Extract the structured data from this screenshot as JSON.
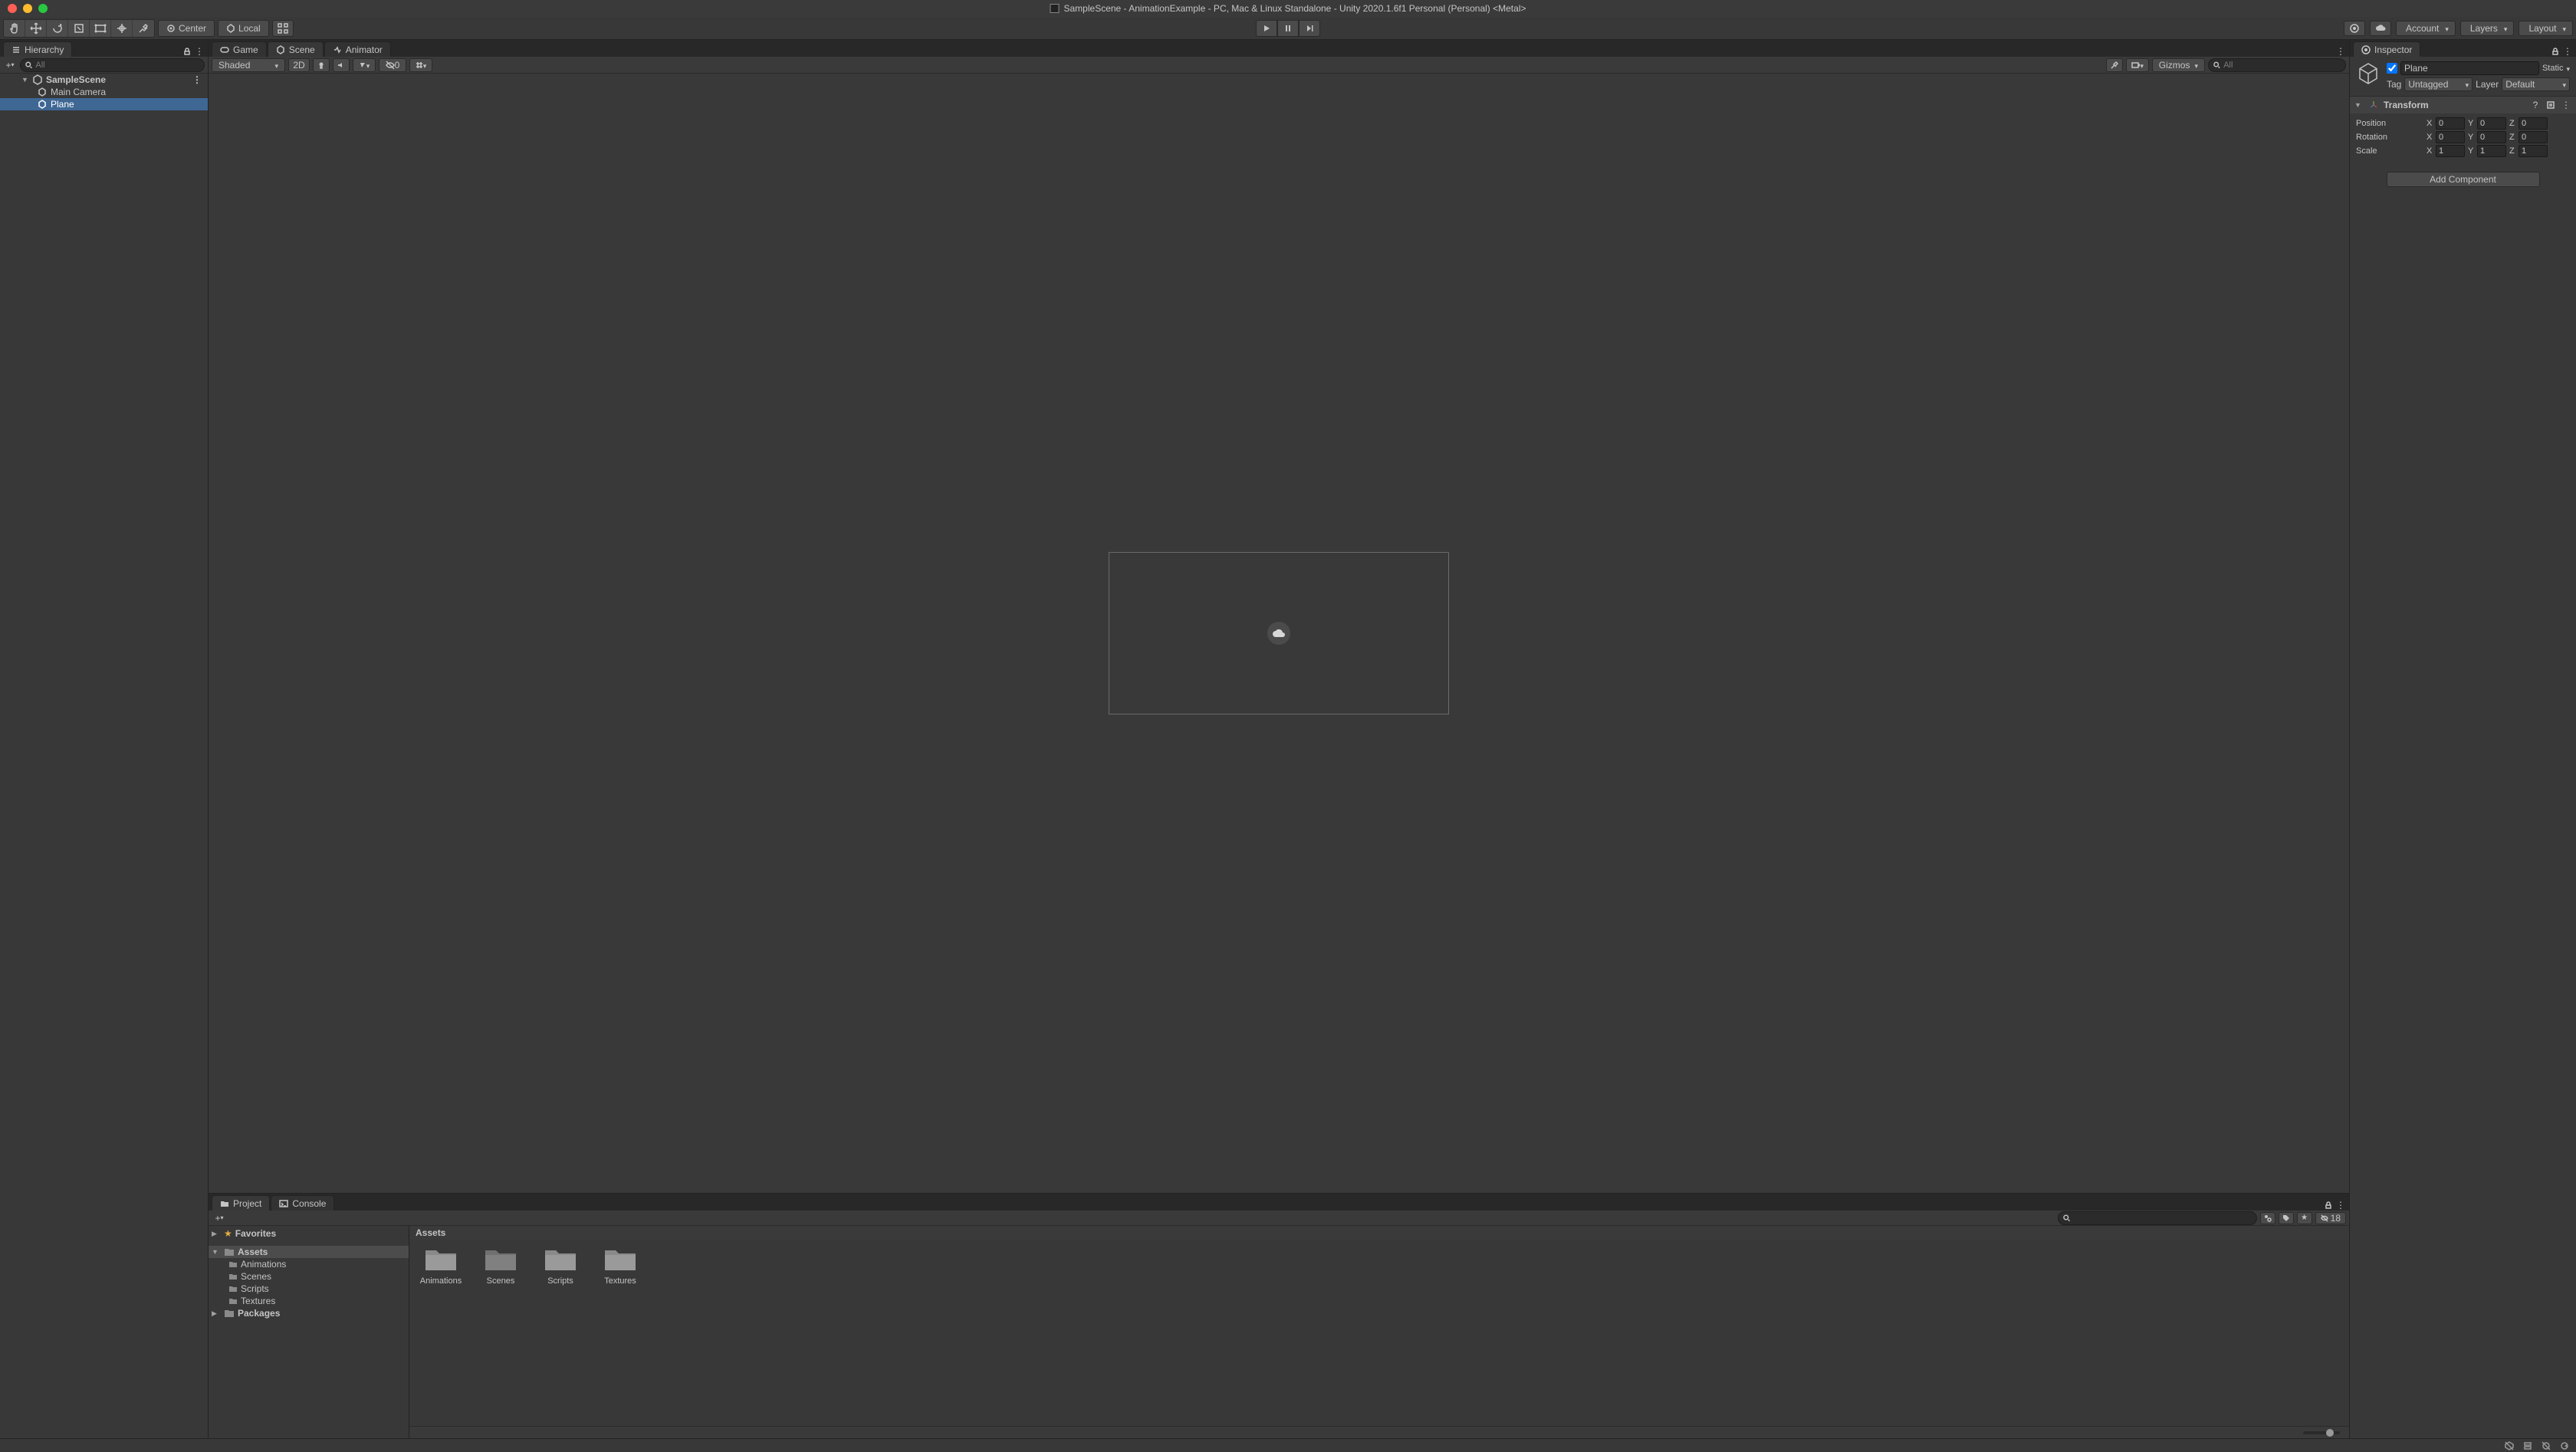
{
  "titlebar": {
    "title": "SampleScene - AnimationExample - PC, Mac & Linux Standalone - Unity 2020.1.6f1 Personal (Personal) <Metal>"
  },
  "toolbar": {
    "pivot_center": "Center",
    "pivot_local": "Local",
    "account": "Account",
    "layers": "Layers",
    "layout": "Layout"
  },
  "hierarchy": {
    "tab": "Hierarchy",
    "search_placeholder": "All",
    "scene": "SampleScene",
    "items": [
      "Main Camera",
      "Plane"
    ],
    "selected": "Plane"
  },
  "center_tabs": {
    "game": "Game",
    "scene": "Scene",
    "animator": "Animator"
  },
  "scene": {
    "shading": "Shaded",
    "mode2d": "2D",
    "gizmos": "Gizmos",
    "cull_count": "0",
    "search_placeholder": "All"
  },
  "inspector": {
    "tab": "Inspector",
    "name": "Plane",
    "static": "Static",
    "tag_label": "Tag",
    "tag_value": "Untagged",
    "layer_label": "Layer",
    "layer_value": "Default",
    "transform": {
      "title": "Transform",
      "rows": {
        "position": {
          "label": "Position",
          "x": "0",
          "y": "0",
          "z": "0"
        },
        "rotation": {
          "label": "Rotation",
          "x": "0",
          "y": "0",
          "z": "0"
        },
        "scale": {
          "label": "Scale",
          "x": "1",
          "y": "1",
          "z": "1"
        }
      }
    },
    "add_component": "Add Component"
  },
  "project": {
    "tabs": {
      "project": "Project",
      "console": "Console"
    },
    "hidden_count": "18",
    "favorites": "Favorites",
    "assets": "Assets",
    "packages": "Packages",
    "folders": [
      "Animations",
      "Scenes",
      "Scripts",
      "Textures"
    ],
    "breadcrumb": "Assets",
    "grid": [
      "Animations",
      "Scenes",
      "Scripts",
      "Textures"
    ]
  }
}
